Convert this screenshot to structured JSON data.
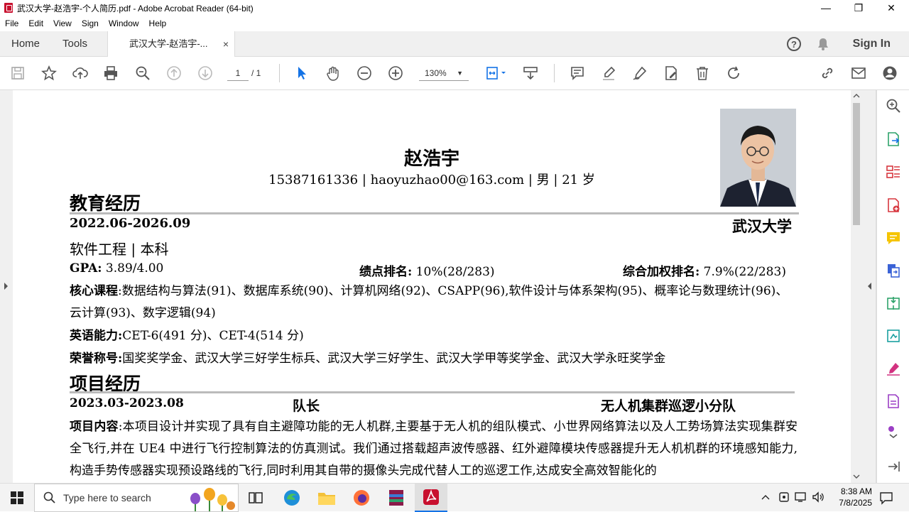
{
  "window": {
    "title": "武汉大学-赵浩宇-个人简历.pdf - Adobe Acrobat Reader (64-bit)",
    "controls": {
      "minimize": "—",
      "maximize": "❐",
      "close": "✕"
    }
  },
  "menu": [
    "File",
    "Edit",
    "View",
    "Sign",
    "Window",
    "Help"
  ],
  "tabs": {
    "home": "Home",
    "tools": "Tools",
    "document": "武汉大学-赵浩宇-...",
    "close": "×",
    "signin": "Sign In"
  },
  "toolbar": {
    "page_current": "1",
    "page_total": "/ 1",
    "zoom": "130%",
    "zoom_caret": "▼"
  },
  "resume": {
    "name": "赵浩宇",
    "contact": "15387161336 | haoyuzhao00@163.com | 男 | 21 岁",
    "education_heading": "教育经历",
    "edu_dates": "2022.06-2026.09",
    "edu_school": "武汉大学",
    "edu_major": "软件工程 | 本科",
    "gpa_label": "GPA:",
    "gpa_value": " 3.89/4.00",
    "rank_label": "绩点排名:",
    "rank_value": " 10%(28/283)",
    "wrank_label": "综合加权排名:",
    "wrank_value": " 7.9%(22/283)",
    "courses_label": "核心课程",
    "courses_value": ":数据结构与算法(91)、数据库系统(90)、计算机网络(92)、CSAPP(96),软件设计与体系架构(95)、概率论与数理统计(96)、云计算(93)、数字逻辑(94)",
    "english_label": "英语能力:",
    "english_value": "CET-6(491 分)、CET-4(514 分)",
    "honors_label": "荣誉称号:",
    "honors_value": "国奖奖学金、武汉大学三好学生标兵、武汉大学三好学生、武汉大学甲等奖学金、武汉大学永旺奖学金",
    "project_heading": "项目经历",
    "proj_dates": "2023.03-2023.08",
    "proj_role": "队长",
    "proj_name": "无人机集群巡逻小分队",
    "proj_label": "项目内容",
    "proj_text": ":本项目设计并实现了具有自主避障功能的无人机群,主要基于无人机的组队模式、小世界网络算法以及人工势场算法实现集群安全飞行,并在 UE4 中进行飞行控制算法的仿真测试。我们通过搭载超声波传感器、红外避障模块传感器提升无人机机群的环境感知能力,构造手势传感器实现预设路线的飞行,同时利用其自带的摄像头完成代替人工的巡逻工作,达成安全高效智能化的"
  },
  "taskbar": {
    "search_placeholder": "Type here to search",
    "time": "8:38 AM",
    "date": "7/8/2025"
  },
  "colors": {
    "acrobat_red": "#c8102e",
    "toolbar_icon": "#555555",
    "select_blue": "#1473e6"
  }
}
